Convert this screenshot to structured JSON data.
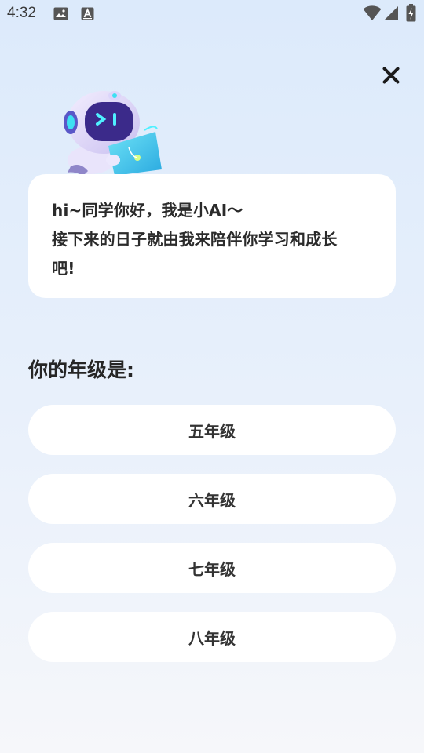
{
  "status_bar": {
    "time": "4:32",
    "icons": [
      "image-icon",
      "text-a-icon",
      "wifi-icon",
      "signal-icon",
      "battery-charging-icon"
    ]
  },
  "close_icon": "close-icon",
  "robot_icon": "robot-mascot-icon",
  "greeting": {
    "lines": [
      "hi~同学你好，我是小AI〜",
      "接下来的日子就由我来陪伴你学习和成长",
      "吧!"
    ]
  },
  "question": "你的年级是:",
  "options": [
    {
      "label": "五年级"
    },
    {
      "label": "六年级"
    },
    {
      "label": "七年级"
    },
    {
      "label": "八年级"
    }
  ],
  "colors": {
    "background_top": "#dceafb",
    "background_bottom": "#f6f7fa",
    "card": "#ffffff",
    "text": "#333333"
  }
}
